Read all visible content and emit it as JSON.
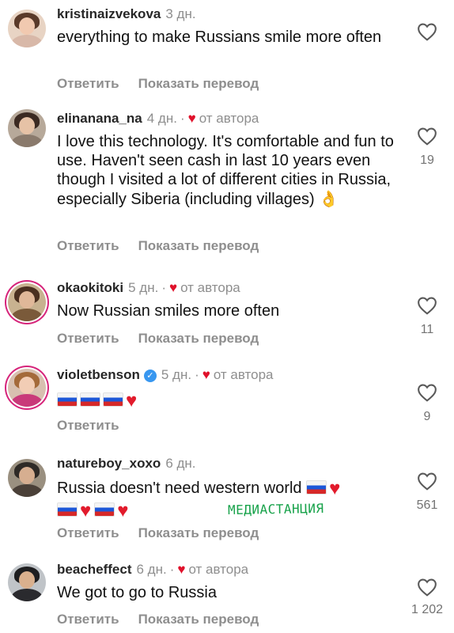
{
  "comments": [
    {
      "username": "kristinaizvekova",
      "time": "3 дн.",
      "author_heart": false,
      "text": "everything to make Russians smile more often",
      "actions": [
        "Ответить",
        "Показать перевод"
      ],
      "likes": ""
    },
    {
      "username": "elinanana_na",
      "time": "4 дн.",
      "author_heart": true,
      "author_label": "от автора",
      "text": "I love this technology. It's comfortable and fun to use. Haven't seen cash in last 10 years even though I visited a lot of different cities in Russia, especially Siberia (including villages)",
      "emoji": "👌",
      "actions": [
        "Ответить",
        "Показать перевод"
      ],
      "likes": "19"
    },
    {
      "username": "okaokitoki",
      "time": "5 дн.",
      "author_heart": true,
      "author_label": "от автора",
      "text": "Now Russian smiles more often",
      "actions": [
        "Ответить",
        "Показать перевод"
      ],
      "likes": "11"
    },
    {
      "username": "violetbenson",
      "verified": true,
      "time": "5 дн.",
      "author_heart": true,
      "author_label": "от автора",
      "text": "",
      "actions": [
        "Ответить"
      ],
      "likes": "9"
    },
    {
      "username": "natureboy_xoxo",
      "time": "6 дн.",
      "author_heart": false,
      "text": "Russia doesn't need western world",
      "actions": [
        "Ответить",
        "Показать перевод"
      ],
      "likes": "561"
    },
    {
      "username": "beacheffect",
      "time": "6 дн.",
      "author_heart": true,
      "author_label": "от автора",
      "text": "We got to go to Russia",
      "actions": [
        "Ответить",
        "Показать перевод"
      ],
      "likes": "1 202"
    }
  ],
  "watermark": "МЕДИАСТАНЦИЯ",
  "icons": {
    "like": "heart-outline-icon",
    "author_heart": "heart-filled-icon",
    "verified": "verified-badge-icon",
    "flag": "russia-flag-icon"
  },
  "colors": {
    "username": "#262626",
    "meta": "#8e8e8e",
    "heart": "#e0112b",
    "verified": "#3897f0",
    "watermark": "#17a24a",
    "story_ring": "#d6247a"
  }
}
